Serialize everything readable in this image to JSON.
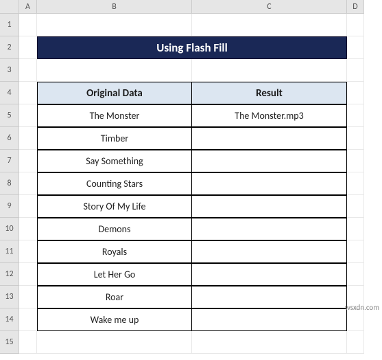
{
  "columns": [
    "A",
    "B",
    "C",
    "D"
  ],
  "rows": [
    "1",
    "2",
    "3",
    "4",
    "5",
    "6",
    "7",
    "8",
    "9",
    "10",
    "11",
    "12",
    "13",
    "14",
    "15"
  ],
  "title": "Using Flash Fill",
  "headers": {
    "original": "Original Data",
    "result": "Result"
  },
  "data": [
    {
      "b": "The Monster",
      "c": "The Monster.mp3"
    },
    {
      "b": "Timber",
      "c": ""
    },
    {
      "b": "Say Something",
      "c": ""
    },
    {
      "b": "Counting Stars",
      "c": ""
    },
    {
      "b": "Story Of My Life",
      "c": ""
    },
    {
      "b": "Demons",
      "c": ""
    },
    {
      "b": "Royals",
      "c": ""
    },
    {
      "b": "Let Her Go",
      "c": ""
    },
    {
      "b": "Roar",
      "c": ""
    },
    {
      "b": "Wake me up",
      "c": ""
    }
  ],
  "watermark": "wsxdn.com",
  "chart_data": {
    "type": "table",
    "title": "Using Flash Fill",
    "columns": [
      "Original Data",
      "Result"
    ],
    "rows": [
      [
        "The Monster",
        "The Monster.mp3"
      ],
      [
        "Timber",
        ""
      ],
      [
        "Say Something",
        ""
      ],
      [
        "Counting Stars",
        ""
      ],
      [
        "Story Of My Life",
        ""
      ],
      [
        "Demons",
        ""
      ],
      [
        "Royals",
        ""
      ],
      [
        "Let Her Go",
        ""
      ],
      [
        "Roar",
        ""
      ],
      [
        "Wake me up",
        ""
      ]
    ]
  }
}
